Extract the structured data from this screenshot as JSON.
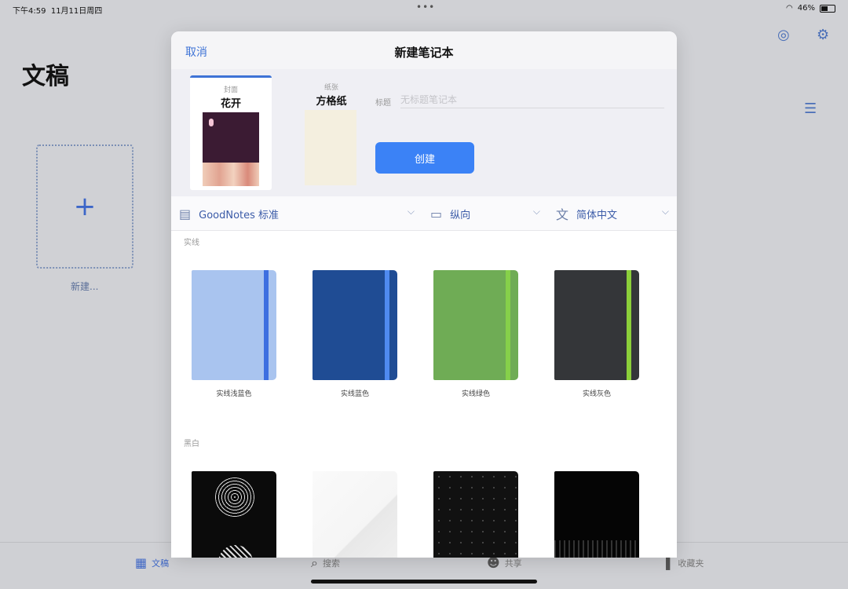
{
  "status": {
    "time": "下午4:59",
    "date": "11月11日周四",
    "battery": "46%"
  },
  "background": {
    "title": "文稿",
    "new_label": "新建...",
    "tabs": [
      {
        "label": "文稿",
        "icon": "grid-icon"
      },
      {
        "label": "搜索",
        "icon": "search-icon"
      },
      {
        "label": "共享",
        "icon": "people-icon"
      },
      {
        "label": "收藏夹",
        "icon": "bookmark-icon"
      }
    ]
  },
  "modal": {
    "cancel": "取消",
    "title": "新建笔记本",
    "cover": {
      "sub": "封面",
      "name": "花开"
    },
    "paper": {
      "sub": "纸张",
      "name": "方格纸"
    },
    "title_label": "标题",
    "title_placeholder": "无标题笔记本",
    "create": "创建",
    "options": {
      "template": "GoodNotes 标准",
      "orientation": "纵向",
      "language": "简体中文"
    },
    "sections": [
      {
        "label": "实线",
        "items": [
          {
            "label": "实线浅蓝色",
            "color": "#a9c4ef",
            "band": "#3d6fe0"
          },
          {
            "label": "实线蓝色",
            "color": "#1f4c94",
            "band": "#4f8af0"
          },
          {
            "label": "实线绿色",
            "color": "#6fac55",
            "band": "#86d04a"
          },
          {
            "label": "实线灰色",
            "color": "#343639",
            "band": "#8bcf3a"
          }
        ]
      },
      {
        "label": "黑白"
      }
    ]
  }
}
